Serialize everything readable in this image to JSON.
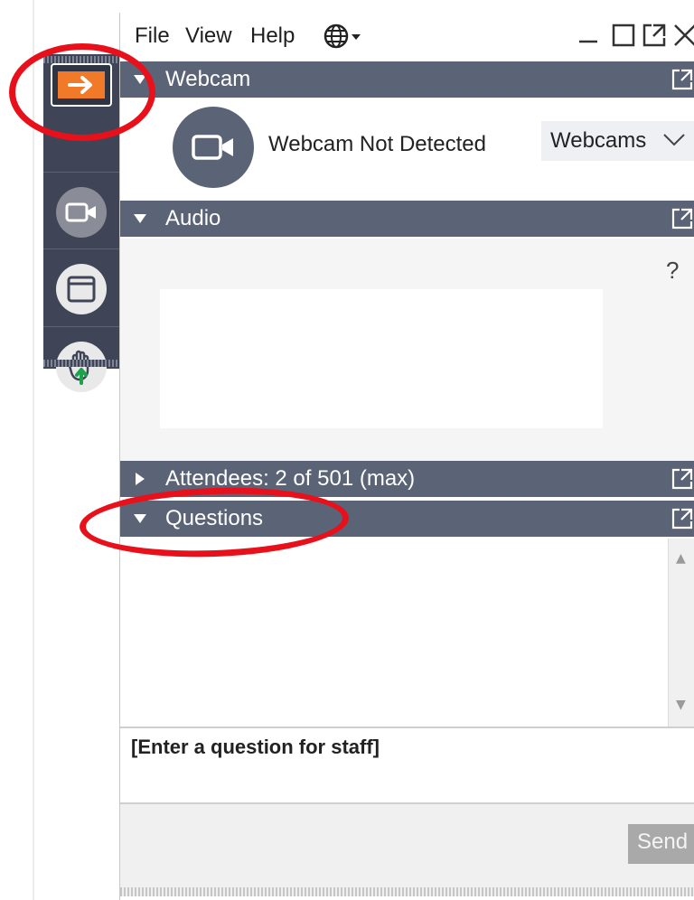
{
  "menubar": {
    "file": "File",
    "view": "View",
    "help": "Help"
  },
  "webcam": {
    "header": "Webcam",
    "status": "Webcam Not Detected",
    "select_value": "Webcams"
  },
  "audio": {
    "header": "Audio",
    "help_label": "?"
  },
  "attendees": {
    "header": "Attendees: 2 of 501 (max)"
  },
  "questions": {
    "header": "Questions",
    "input_placeholder": "[Enter a question for staff]",
    "send_label": "Send"
  },
  "colors": {
    "header_bg": "#5b6377",
    "sidebar_bg": "#3f4556",
    "accent_orange": "#f07a28",
    "annotation_red": "#e8101a"
  },
  "icons": [
    "globe-icon",
    "minimize-icon",
    "maximize-icon",
    "popout-icon",
    "close-icon",
    "camera-icon",
    "screen-icon",
    "raise-hand-icon",
    "arrow-right-icon"
  ]
}
